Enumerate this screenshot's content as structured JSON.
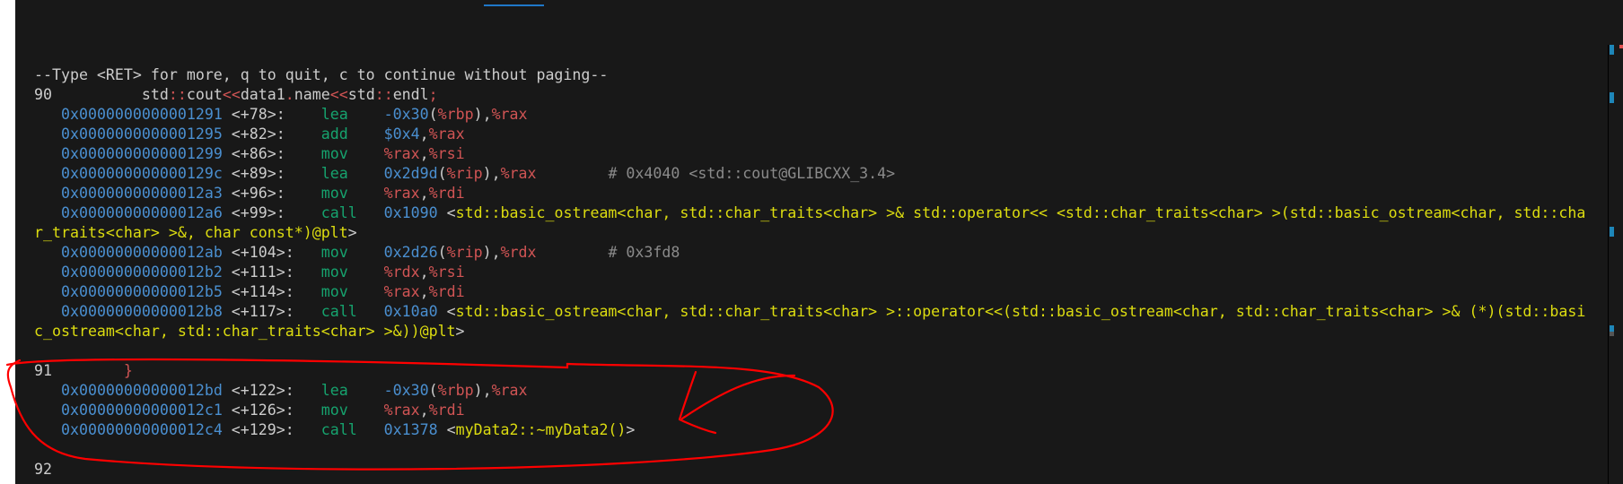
{
  "colors": {
    "d": "#cccccc",
    "addr": "#4a8fd0",
    "mn": "#16a36e",
    "reg": "#d05454",
    "sym": "#dcdc10",
    "cm": "#8a8a8a",
    "op": "#d05454",
    "annotation": "#ff0000",
    "background": "#181818"
  },
  "terminal": {
    "lines": [
      [
        [
          "--Type <RET> for more, q to quit, c to continue without paging--",
          "d"
        ]
      ],
      [
        [
          "90          ",
          "d"
        ],
        [
          "std",
          "d"
        ],
        [
          "::",
          "op"
        ],
        [
          "cout",
          "d"
        ],
        [
          "<<",
          "op"
        ],
        [
          "data1",
          "d"
        ],
        [
          ".",
          "op"
        ],
        [
          "name",
          "d"
        ],
        [
          "<<",
          "op"
        ],
        [
          "std",
          "d"
        ],
        [
          "::",
          "op"
        ],
        [
          "endl",
          "d"
        ],
        [
          ";",
          "op"
        ]
      ],
      [
        [
          "   ",
          "d"
        ],
        [
          "0x0000000000001291",
          "addr"
        ],
        [
          " <+78>:    ",
          "d"
        ],
        [
          "lea    ",
          "mn"
        ],
        [
          "-0x30",
          "addr"
        ],
        [
          "(",
          "d"
        ],
        [
          "%rbp",
          "reg"
        ],
        [
          "),",
          "d"
        ],
        [
          "%rax",
          "reg"
        ]
      ],
      [
        [
          "   ",
          "d"
        ],
        [
          "0x0000000000001295",
          "addr"
        ],
        [
          " <+82>:    ",
          "d"
        ],
        [
          "add    ",
          "mn"
        ],
        [
          "$0x4",
          "addr"
        ],
        [
          ",",
          "d"
        ],
        [
          "%rax",
          "reg"
        ]
      ],
      [
        [
          "   ",
          "d"
        ],
        [
          "0x0000000000001299",
          "addr"
        ],
        [
          " <+86>:    ",
          "d"
        ],
        [
          "mov    ",
          "mn"
        ],
        [
          "%rax",
          "reg"
        ],
        [
          ",",
          "d"
        ],
        [
          "%rsi",
          "reg"
        ]
      ],
      [
        [
          "   ",
          "d"
        ],
        [
          "0x000000000000129c",
          "addr"
        ],
        [
          " <+89>:    ",
          "d"
        ],
        [
          "lea    ",
          "mn"
        ],
        [
          "0x2d9d",
          "addr"
        ],
        [
          "(",
          "d"
        ],
        [
          "%rip",
          "reg"
        ],
        [
          "),",
          "d"
        ],
        [
          "%rax",
          "reg"
        ],
        [
          "        # 0x4040 <std::cout@GLIBCXX_3.4>",
          "cm"
        ]
      ],
      [
        [
          "   ",
          "d"
        ],
        [
          "0x00000000000012a3",
          "addr"
        ],
        [
          " <+96>:    ",
          "d"
        ],
        [
          "mov    ",
          "mn"
        ],
        [
          "%rax",
          "reg"
        ],
        [
          ",",
          "d"
        ],
        [
          "%rdi",
          "reg"
        ]
      ],
      [
        [
          "   ",
          "d"
        ],
        [
          "0x00000000000012a6",
          "addr"
        ],
        [
          " <+99>:    ",
          "d"
        ],
        [
          "call   ",
          "mn"
        ],
        [
          "0x1090",
          "addr"
        ],
        [
          " <",
          "d"
        ],
        [
          "std::basic_ostream<char, std::char_traits<char> >& std::operator<< <std::char_traits<char> >(std::basic_ostream<char, std::cha",
          "sym"
        ]
      ],
      [
        [
          "r_traits<char> >&, char const*)@plt",
          "sym"
        ],
        [
          ">",
          "d"
        ]
      ],
      [
        [
          "   ",
          "d"
        ],
        [
          "0x00000000000012ab",
          "addr"
        ],
        [
          " <+104>:   ",
          "d"
        ],
        [
          "mov    ",
          "mn"
        ],
        [
          "0x2d26",
          "addr"
        ],
        [
          "(",
          "d"
        ],
        [
          "%rip",
          "reg"
        ],
        [
          "),",
          "d"
        ],
        [
          "%rdx",
          "reg"
        ],
        [
          "        # 0x3fd8",
          "cm"
        ]
      ],
      [
        [
          "   ",
          "d"
        ],
        [
          "0x00000000000012b2",
          "addr"
        ],
        [
          " <+111>:   ",
          "d"
        ],
        [
          "mov    ",
          "mn"
        ],
        [
          "%rdx",
          "reg"
        ],
        [
          ",",
          "d"
        ],
        [
          "%rsi",
          "reg"
        ]
      ],
      [
        [
          "   ",
          "d"
        ],
        [
          "0x00000000000012b5",
          "addr"
        ],
        [
          " <+114>:   ",
          "d"
        ],
        [
          "mov    ",
          "mn"
        ],
        [
          "%rax",
          "reg"
        ],
        [
          ",",
          "d"
        ],
        [
          "%rdi",
          "reg"
        ]
      ],
      [
        [
          "   ",
          "d"
        ],
        [
          "0x00000000000012b8",
          "addr"
        ],
        [
          " <+117>:   ",
          "d"
        ],
        [
          "call   ",
          "mn"
        ],
        [
          "0x10a0",
          "addr"
        ],
        [
          " <",
          "d"
        ],
        [
          "std::basic_ostream<char, std::char_traits<char> >::operator<<(std::basic_ostream<char, std::char_traits<char> >& (*)(std::basi",
          "sym"
        ]
      ],
      [
        [
          "c_ostream<char, std::char_traits<char> >&))@plt",
          "sym"
        ],
        [
          ">",
          "d"
        ]
      ],
      [
        [
          "",
          "d"
        ]
      ],
      [
        [
          "91        ",
          "d"
        ],
        [
          "}",
          "op"
        ]
      ],
      [
        [
          "   ",
          "d"
        ],
        [
          "0x00000000000012bd",
          "addr"
        ],
        [
          " <+122>:   ",
          "d"
        ],
        [
          "lea    ",
          "mn"
        ],
        [
          "-0x30",
          "addr"
        ],
        [
          "(",
          "d"
        ],
        [
          "%rbp",
          "reg"
        ],
        [
          "),",
          "d"
        ],
        [
          "%rax",
          "reg"
        ]
      ],
      [
        [
          "   ",
          "d"
        ],
        [
          "0x00000000000012c1",
          "addr"
        ],
        [
          " <+126>:   ",
          "d"
        ],
        [
          "mov    ",
          "mn"
        ],
        [
          "%rax",
          "reg"
        ],
        [
          ",",
          "d"
        ],
        [
          "%rdi",
          "reg"
        ]
      ],
      [
        [
          "   ",
          "d"
        ],
        [
          "0x00000000000012c4",
          "addr"
        ],
        [
          " <+129>:   ",
          "d"
        ],
        [
          "call   ",
          "mn"
        ],
        [
          "0x1378",
          "addr"
        ],
        [
          " <",
          "d"
        ],
        [
          "myData2::~myData2()",
          "sym"
        ],
        [
          ">",
          "d"
        ]
      ],
      [
        [
          "",
          "d"
        ]
      ],
      [
        [
          "92",
          "d"
        ]
      ]
    ]
  },
  "annotation": {
    "shape": "freehand-circle-and-arrow",
    "target": "destructor call lines 91"
  }
}
